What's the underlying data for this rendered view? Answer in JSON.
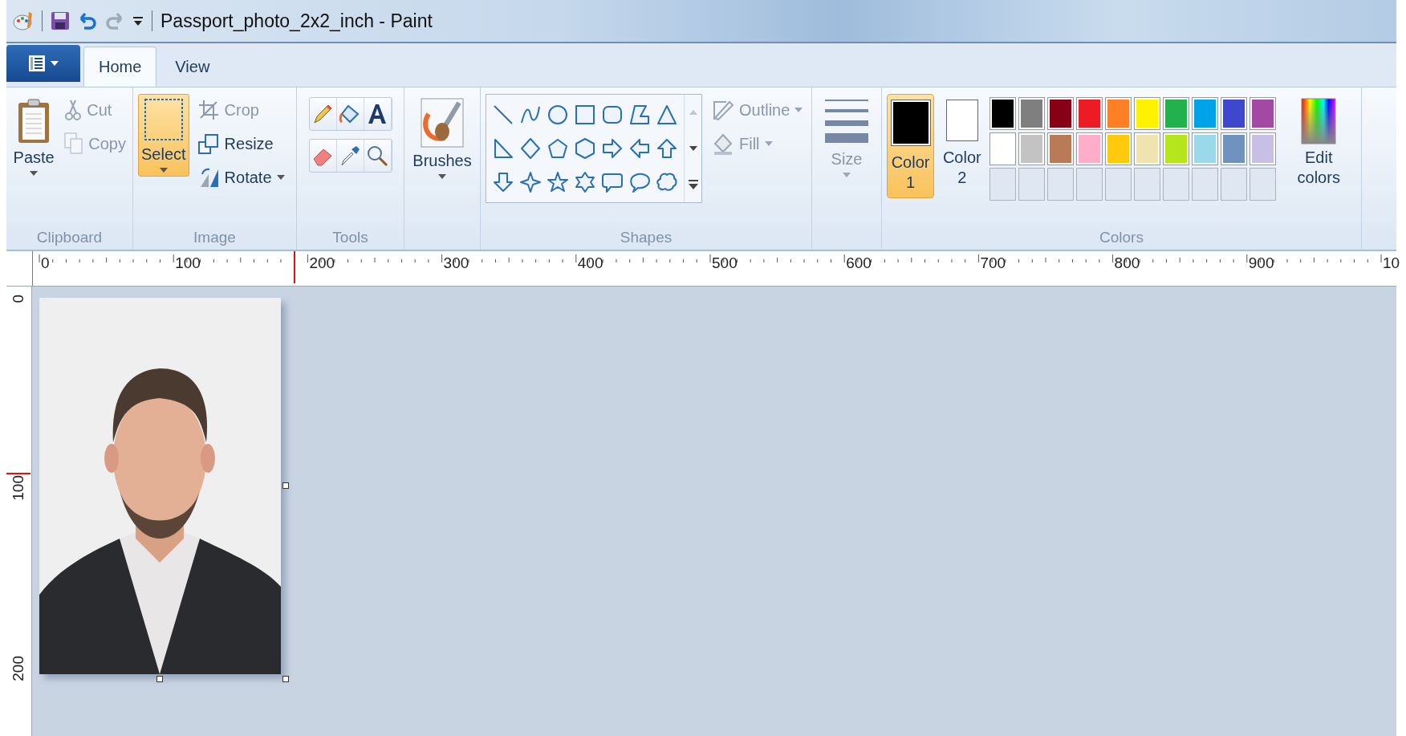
{
  "window": {
    "title": "Passport_photo_2x2_inch - Paint"
  },
  "tabs": [
    {
      "label": "Home",
      "selected": true
    },
    {
      "label": "View",
      "selected": false
    }
  ],
  "clipboard": {
    "paste": "Paste",
    "items": [
      {
        "label": "Cut",
        "disabled": true
      },
      {
        "label": "Copy",
        "disabled": true
      }
    ],
    "group_label": "Clipboard"
  },
  "image": {
    "select": {
      "label": "Select",
      "selected": true
    },
    "items": [
      {
        "label": "Crop",
        "disabled": true
      },
      {
        "label": "Resize",
        "disabled": false
      },
      {
        "label": "Rotate",
        "disabled": false
      }
    ],
    "group_label": "Image"
  },
  "tools": {
    "group_label": "Tools"
  },
  "brushes": {
    "label": "Brushes"
  },
  "shapes": {
    "items": [
      {
        "label": "Outline",
        "disabled": true
      },
      {
        "label": "Fill",
        "disabled": true
      }
    ],
    "group_label": "Shapes"
  },
  "size": {
    "label": "Size",
    "disabled": true
  },
  "colors": {
    "color1": {
      "label": "Color 1",
      "selected": true,
      "color": "#000000"
    },
    "color2": {
      "label": "Color 2",
      "selected": false,
      "color": "#ffffff"
    },
    "palette": [
      {
        "color": "#000000"
      },
      {
        "color": "#7f7f7f"
      },
      {
        "color": "#880015"
      },
      {
        "color": "#ed1c24"
      },
      {
        "color": "#ff7f27"
      },
      {
        "color": "#fff200"
      },
      {
        "color": "#22b14c"
      },
      {
        "color": "#00a2e8"
      },
      {
        "color": "#3f48cc"
      },
      {
        "color": "#a349a4"
      },
      {
        "color": "#ffffff"
      },
      {
        "color": "#c3c3c3"
      },
      {
        "color": "#b97a57"
      },
      {
        "color": "#ffaec9"
      },
      {
        "color": "#ffc90e"
      },
      {
        "color": "#efe4b0"
      },
      {
        "color": "#b5e61d"
      },
      {
        "color": "#99d9ea"
      },
      {
        "color": "#7092be"
      },
      {
        "color": "#c8bfe7"
      }
    ],
    "edit_colors": "Edit colors",
    "group_label": "Colors"
  },
  "rulers": {
    "horizontal": [
      "0",
      "100",
      "200",
      "300",
      "400",
      "500",
      "600",
      "700",
      "800",
      "900",
      "10"
    ],
    "vertical": [
      "0",
      "100",
      "200"
    ]
  }
}
